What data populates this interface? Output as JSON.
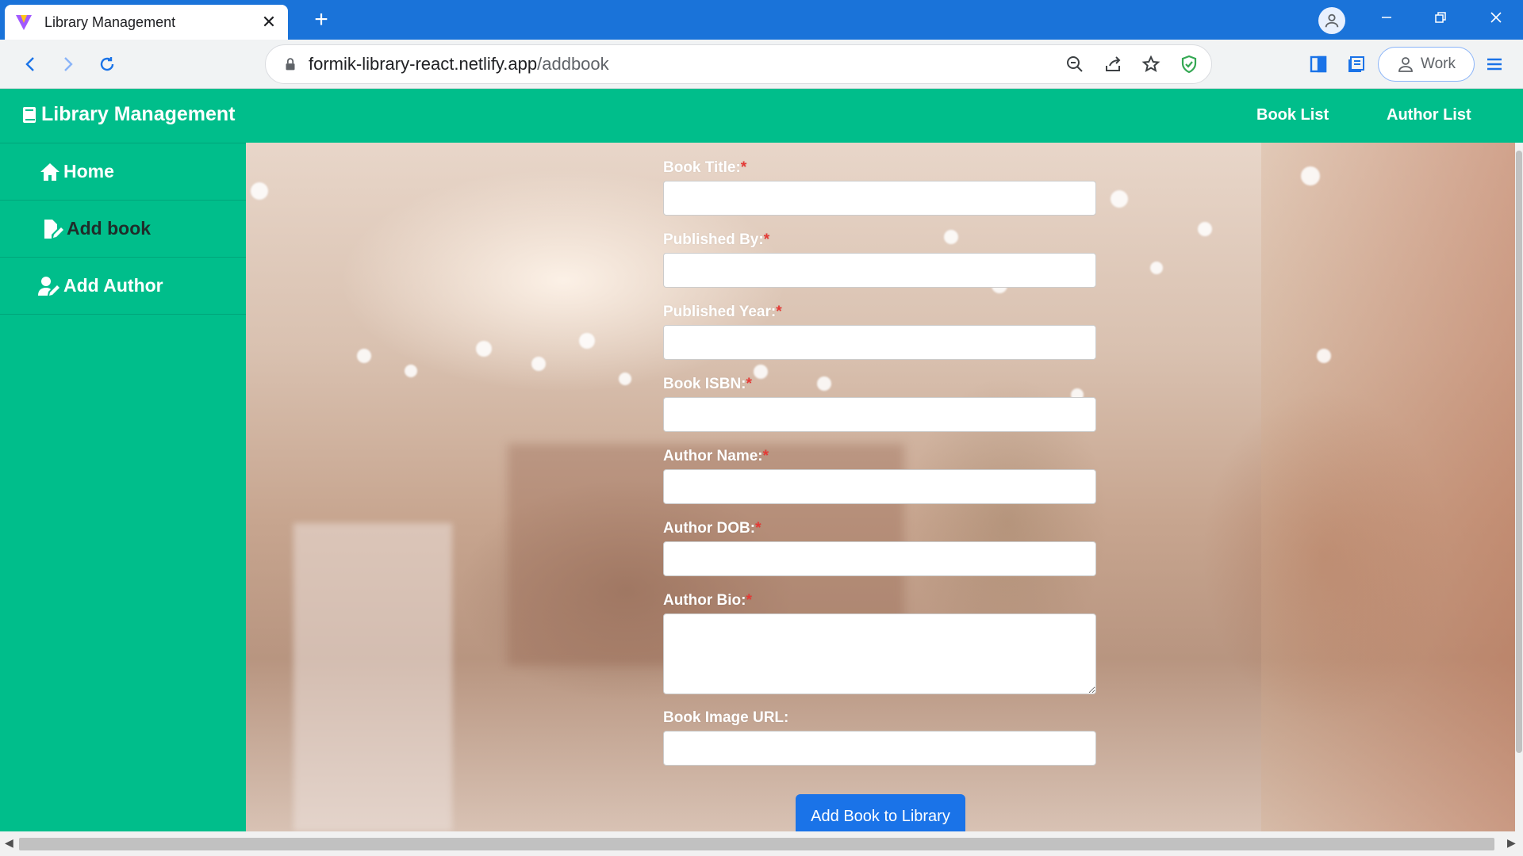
{
  "browser": {
    "tab_title": "Library Management",
    "tab_close": "✕",
    "new_tab": "+",
    "url_host": "formik-library-react.netlify.app",
    "url_path": "/addbook",
    "profile_label": "Work"
  },
  "app": {
    "brand": "Library Management",
    "header_links": [
      "Book List",
      "Author List"
    ],
    "sidebar": [
      {
        "label": "Home",
        "icon": "home-icon"
      },
      {
        "label": "Add book",
        "icon": "file-edit-icon"
      },
      {
        "label": "Add Author",
        "icon": "user-edit-icon"
      }
    ],
    "colors": {
      "primary": "#00be8b",
      "button": "#1a73e8",
      "required": "#e53935"
    }
  },
  "form": {
    "required_mark": "*",
    "fields": [
      {
        "label": "Book Title:",
        "required": true,
        "value": ""
      },
      {
        "label": "Published By:",
        "required": true,
        "value": ""
      },
      {
        "label": "Published Year:",
        "required": true,
        "value": ""
      },
      {
        "label": "Book ISBN:",
        "required": true,
        "value": ""
      },
      {
        "label": "Author Name:",
        "required": true,
        "value": ""
      },
      {
        "label": "Author DOB:",
        "required": true,
        "value": ""
      },
      {
        "label": "Author Bio:",
        "required": true,
        "value": ""
      },
      {
        "label": "Book Image URL:",
        "required": false,
        "value": ""
      }
    ],
    "submit_label": "Add Book to Library"
  }
}
